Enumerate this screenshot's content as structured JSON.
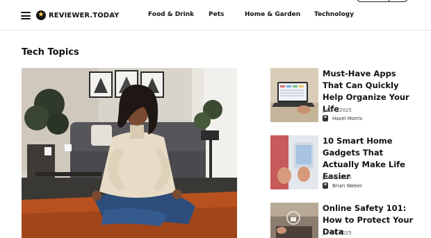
{
  "header": {
    "logo_text": "REVIEWER.TODAY",
    "nav": [
      "Food & Drink",
      "Pets",
      "Home & Garden",
      "Technology"
    ]
  },
  "section": {
    "title": "Tech Topics"
  },
  "articles": [
    {
      "title": "Must-Have Apps That Can Quickly Help Organize Your Life",
      "date": "Jul 24, 2025",
      "author": "Hazel Morris"
    },
    {
      "title": "10 Smart Home Gadgets That Actually Make Life Easier",
      "date": "Jul 24, 2025",
      "author": "Brian Weber"
    },
    {
      "title": "Online Safety 101: How to Protect Your Data",
      "date": "Jul 24, 2025",
      "author": ""
    }
  ],
  "colors": {
    "accent_star": "#f4c84a",
    "text": "#111111",
    "rug": "#b8511e",
    "sweater": "#e8dcc6"
  }
}
